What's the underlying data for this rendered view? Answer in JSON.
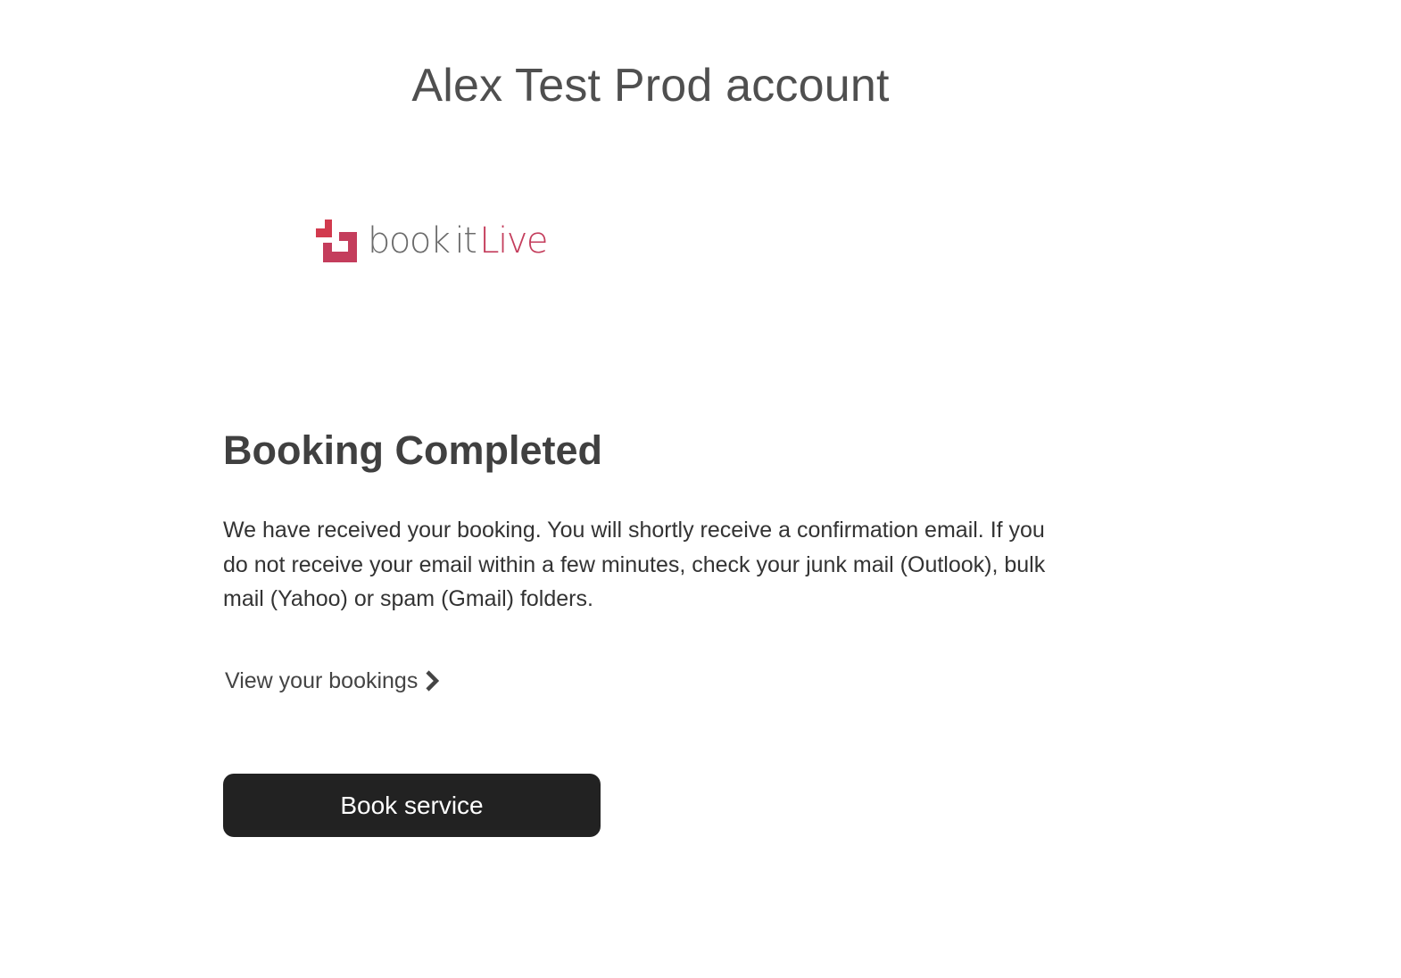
{
  "header": {
    "account_name": "Alex Test Prod account"
  },
  "logo": {
    "name": "book it Live",
    "word1": "book",
    "word2": "it",
    "word3": "Live",
    "colors": {
      "brand_red": "#c43d5c",
      "brand_grey": "#6b6b6b"
    }
  },
  "main": {
    "heading": "Booking Completed",
    "message": "We have received your booking. You will shortly receive a confirmation email. If you do not receive your email within a few minutes, check your junk mail (Outlook), bulk mail (Yahoo) or spam (Gmail) folders.",
    "view_bookings_link": "View your bookings",
    "view_bookings_icon": "chevron-right-icon",
    "book_service_button": "Book service"
  },
  "colors": {
    "button_bg": "#222222",
    "button_text": "#ffffff"
  }
}
